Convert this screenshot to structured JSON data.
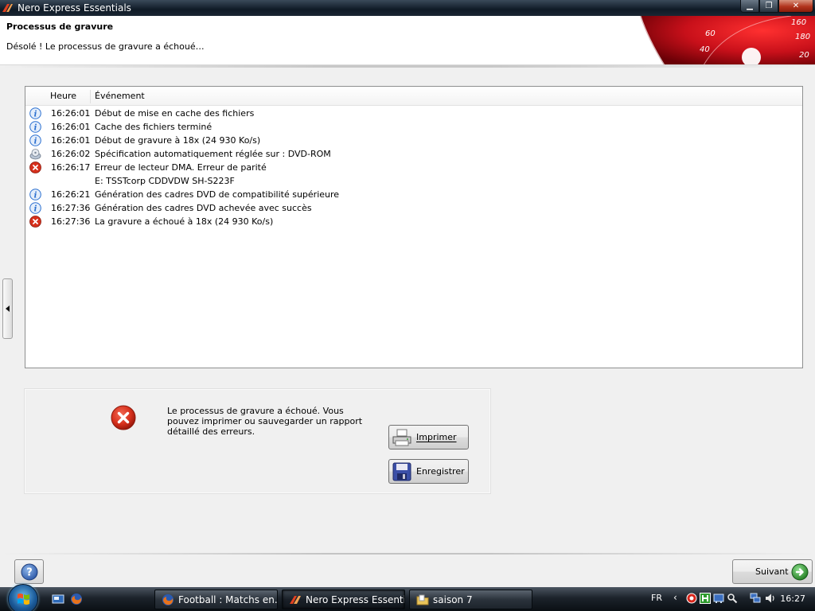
{
  "window": {
    "title": "Nero Express Essentials",
    "minimize_glyph": "▁",
    "maximize_glyph": "❐",
    "close_glyph": "✕"
  },
  "header": {
    "title": "Processus de gravure",
    "subtitle": "Désolé ! Le processus de gravure a échoué…",
    "speedometer_numbers": [
      "160",
      "180",
      "60",
      "40",
      "20"
    ]
  },
  "log": {
    "columns": [
      "Heure",
      "Événement"
    ],
    "rows": [
      {
        "icon": "info",
        "time": "16:26:01",
        "event": "Début de mise en cache des fichiers"
      },
      {
        "icon": "info",
        "time": "16:26:01",
        "event": "Cache des fichiers terminé"
      },
      {
        "icon": "info",
        "time": "16:26:01",
        "event": "Début de gravure à 18x (24 930 Ko/s)"
      },
      {
        "icon": "disc",
        "time": "16:26:02",
        "event": "Spécification automatiquement réglée sur : DVD-ROM"
      },
      {
        "icon": "error",
        "time": "16:26:17",
        "event": "Erreur de lecteur DMA. Erreur de parité"
      },
      {
        "icon": "none",
        "time": "",
        "event": "E: TSSTcorp CDDVDW SH-S223F"
      },
      {
        "icon": "info",
        "time": "16:26:21",
        "event": "Génération des cadres DVD de compatibilité supérieure"
      },
      {
        "icon": "info",
        "time": "16:27:36",
        "event": "Génération des cadres DVD achevée avec succès"
      },
      {
        "icon": "error",
        "time": "16:27:36",
        "event": "La gravure a échoué à 18x (24 930 Ko/s)"
      }
    ]
  },
  "message": {
    "text": "Le processus de gravure a échoué. Vous pouvez imprimer ou sauvegarder un rapport détaillé des erreurs.",
    "print_label": "Imprimer",
    "save_label": "Enregistrer"
  },
  "footer": {
    "help_label": "?",
    "next_label": "Suivant"
  },
  "taskbar": {
    "tasks": [
      {
        "label": "Football : Matchs en...",
        "icon": "firefox-icon",
        "active": false
      },
      {
        "label": "Nero Express Essenti...",
        "icon": "nero-icon",
        "active": true
      },
      {
        "label": "saison 7",
        "icon": "folder-icon",
        "active": false
      }
    ],
    "language": "FR",
    "chevron": "‹",
    "clock": "16:27"
  },
  "colors": {
    "error_red": "#d6301c",
    "info_blue": "#2a6fd0",
    "next_green": "#2e9b2e",
    "header_red": "#c8101a"
  }
}
